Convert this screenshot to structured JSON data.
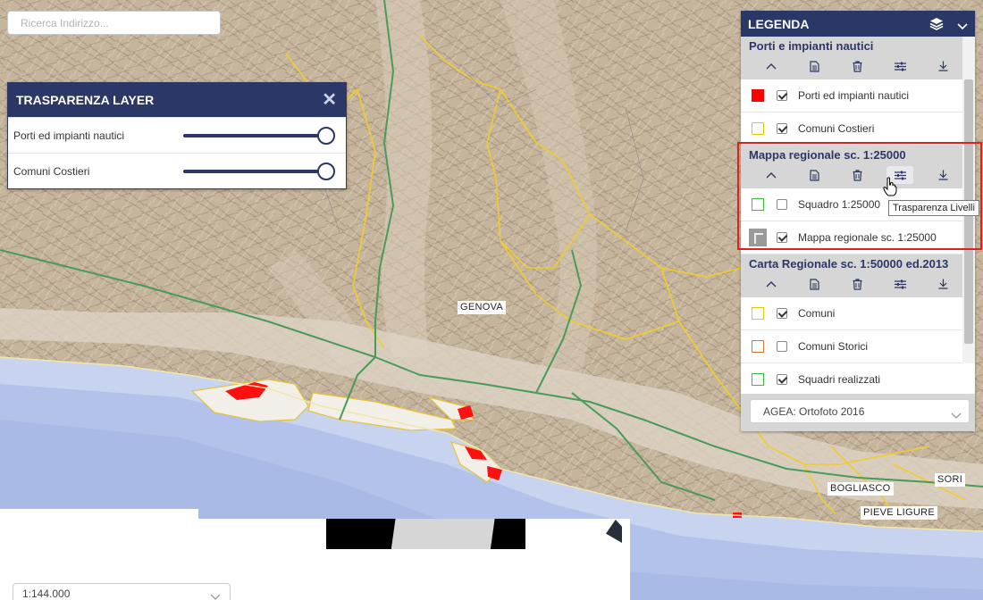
{
  "search": {
    "placeholder": "Ricerca Indirizzo..."
  },
  "transparency_panel": {
    "title": "TRASPARENZA LAYER",
    "close_icon": "close-icon",
    "rows": [
      {
        "label": "Porti ed impianti nautici",
        "opacity_percent": 100
      },
      {
        "label": "Comuni Costieri",
        "opacity_percent": 100
      }
    ]
  },
  "legend": {
    "title": "LEGENDA",
    "icons": [
      "layers-icon",
      "chevron-down-icon"
    ],
    "group_tools": [
      "chevron-up-icon",
      "document-icon",
      "trash-icon",
      "sliders-icon",
      "download-icon"
    ],
    "groups": [
      {
        "title": "Porti e impianti nautici",
        "layers": [
          {
            "label": "Porti ed impianti nautici",
            "checked": true,
            "swatch_fill": "#ff0000",
            "swatch_border": "#ff0000"
          },
          {
            "label": "Comuni Costieri",
            "checked": true,
            "swatch_fill": "#ffffff",
            "swatch_border": "#e8c800"
          }
        ]
      },
      {
        "title": "Mappa regionale sc. 1:25000",
        "layers": [
          {
            "label": "Squadro 1:25000",
            "checked": false,
            "swatch_fill": "#ffffff",
            "swatch_border": "#3cbf3c"
          },
          {
            "label": "Mappa regionale sc. 1:25000",
            "checked": true,
            "thumbnail": true
          }
        ]
      },
      {
        "title": "Carta Regionale sc. 1:50000 ed.2013",
        "layers": [
          {
            "label": "Comuni",
            "checked": true,
            "swatch_fill": "#ffffff",
            "swatch_border": "#e8c800"
          },
          {
            "label": "Comuni Storici",
            "checked": false,
            "swatch_fill": "#ffffff",
            "swatch_border": "#d9772e"
          },
          {
            "label": "Squadri realizzati",
            "checked": true,
            "swatch_fill": "#ffffff",
            "swatch_border": "#3cbf3c"
          }
        ]
      }
    ],
    "basemap": "AGEA: Ortofoto 2016"
  },
  "tooltip": "Trasparenza Livelli",
  "scale": "1:144.000",
  "map_labels": [
    "GENOVA",
    "BOGLIASCO",
    "PIEVE LIGURE",
    "SORI"
  ],
  "colors": {
    "panel_header": "#2b3766",
    "highlight": "#e31f1f",
    "sea": "#c7d3ef",
    "terrain": "#c9bba6"
  }
}
